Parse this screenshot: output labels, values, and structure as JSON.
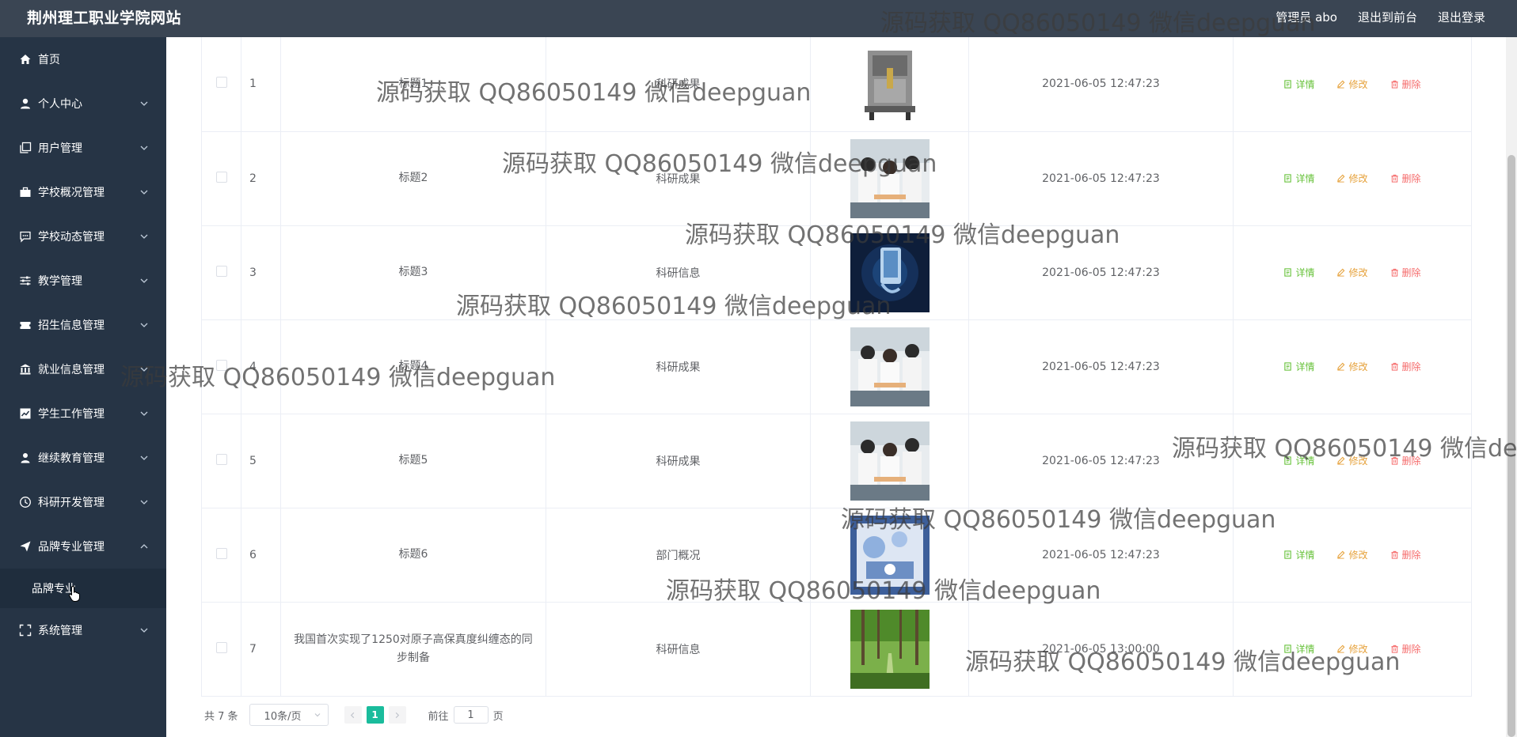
{
  "header": {
    "site_title": "荆州理工职业学院网站",
    "user_label": "管理员 abo",
    "front_link": "退出到前台",
    "logout_link": "退出登录"
  },
  "sidebar": {
    "items": [
      {
        "label": "首页",
        "icon": "home-icon",
        "expandable": false
      },
      {
        "label": "个人中心",
        "icon": "user-icon",
        "expandable": true
      },
      {
        "label": "用户管理",
        "icon": "copy-icon",
        "expandable": true
      },
      {
        "label": "学校概况管理",
        "icon": "briefcase-icon",
        "expandable": true
      },
      {
        "label": "学校动态管理",
        "icon": "chat-icon",
        "expandable": true
      },
      {
        "label": "教学管理",
        "icon": "sliders-icon",
        "expandable": true
      },
      {
        "label": "招生信息管理",
        "icon": "ticket-icon",
        "expandable": true
      },
      {
        "label": "就业信息管理",
        "icon": "bank-icon",
        "expandable": true
      },
      {
        "label": "学生工作管理",
        "icon": "chart-icon",
        "expandable": true
      },
      {
        "label": "继续教育管理",
        "icon": "person-icon",
        "expandable": true
      },
      {
        "label": "科研开发管理",
        "icon": "clock-icon",
        "expandable": true
      },
      {
        "label": "品牌专业管理",
        "icon": "send-icon",
        "expandable": true,
        "open": true
      }
    ],
    "submenu_label": "品牌专业",
    "last_item": {
      "label": "系统管理",
      "icon": "fullscreen-icon"
    }
  },
  "table": {
    "rows": [
      {
        "index": "1",
        "title": "标题1",
        "type": "科研成果",
        "time": "2021-06-05 12:47:23",
        "image": "machine"
      },
      {
        "index": "2",
        "title": "标题2",
        "type": "科研成果",
        "time": "2021-06-05 12:47:23",
        "image": "lab"
      },
      {
        "index": "3",
        "title": "标题3",
        "type": "科研信息",
        "time": "2021-06-05 12:47:23",
        "image": "tech"
      },
      {
        "index": "4",
        "title": "标题4",
        "type": "科研成果",
        "time": "2021-06-05 12:47:23",
        "image": "lab"
      },
      {
        "index": "5",
        "title": "标题5",
        "type": "科研成果",
        "time": "2021-06-05 12:47:23",
        "image": "lab"
      },
      {
        "index": "6",
        "title": "标题6",
        "type": "部门概况",
        "time": "2021-06-05 12:47:23",
        "image": "glass"
      },
      {
        "index": "7",
        "title": "我国首次实现了1250对原子高保真度纠缠态的同步制备",
        "type": "科研信息",
        "time": "2021-06-05 13:00:00",
        "image": "forest"
      }
    ],
    "actions": {
      "detail": "详情",
      "edit": "修改",
      "delete": "删除"
    }
  },
  "pagination": {
    "total": "共 7 条",
    "page_size": "10条/页",
    "current_page": "1",
    "goto_prefix": "前往",
    "goto_value": "1",
    "goto_suffix": "页"
  },
  "watermark": "源码获取 QQ86050149 微信deepguan",
  "colors": {
    "header_bg": "#3a4553",
    "sidebar_bg": "#263445",
    "submenu_bg": "#1f2d3d",
    "detail": "#67c23a",
    "edit": "#e6a23c",
    "delete": "#f56c6c",
    "pager_active": "#1abc9c"
  }
}
